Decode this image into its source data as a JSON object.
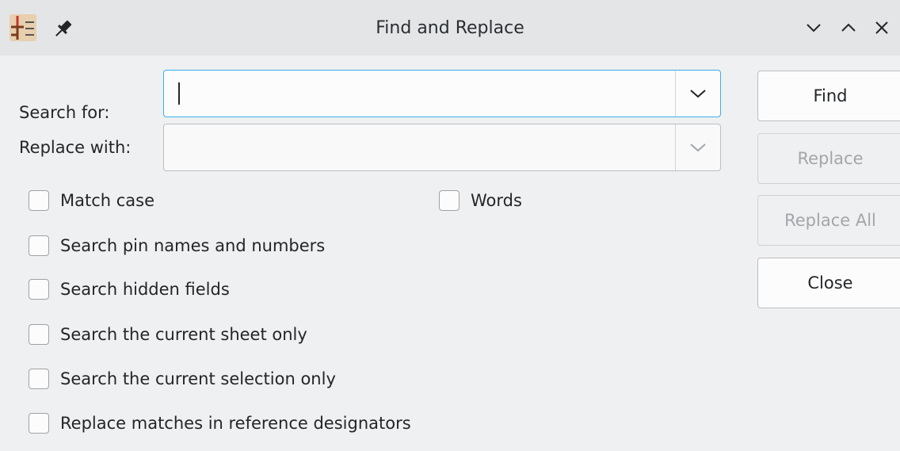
{
  "window": {
    "title": "Find and Replace",
    "icons": [
      "kicad-eeschema-app-icon",
      "pin-icon",
      "minimize-icon",
      "maximize-icon",
      "close-icon"
    ]
  },
  "form": {
    "search_label": "Search for:",
    "search_value": "",
    "replace_label": "Replace with:",
    "replace_value": ""
  },
  "options": {
    "match_case": "Match case",
    "words": "Words",
    "pin_names": "Search pin names and numbers",
    "hidden_fields": "Search hidden fields",
    "current_sheet": "Search the current sheet only",
    "current_selection": "Search the current selection only",
    "reference_designators": "Replace matches in reference designators"
  },
  "buttons": {
    "find": "Find",
    "replace": "Replace",
    "replace_all": "Replace All",
    "close": "Close"
  },
  "colors": {
    "focus_border": "#3daee9",
    "background": "#eff0f1"
  }
}
